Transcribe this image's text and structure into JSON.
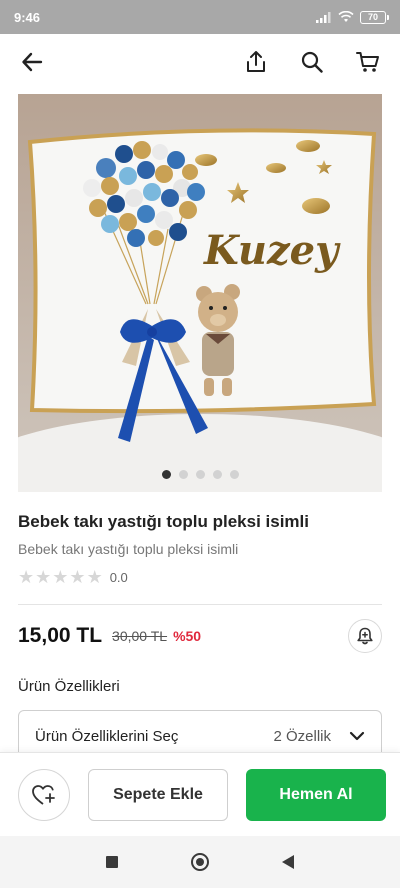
{
  "status_bar": {
    "time": "9:46",
    "battery": "70"
  },
  "header": {
    "back_icon": "arrow-left-icon",
    "share_icon": "share-icon",
    "search_icon": "search-icon",
    "cart_icon": "cart-icon"
  },
  "product": {
    "image_text": "Kuzey",
    "image_count": 5,
    "active_image": 1,
    "title": "Bebek takı yastığı toplu pleksi isimli",
    "subtitle": "Bebek takı yastığı toplu pleksi isimli",
    "rating_value": "0.0",
    "rating_stars": 0,
    "price": "15,00 TL",
    "old_price": "30,00 TL",
    "discount": "%50"
  },
  "features": {
    "label": "Ürün Özellikleri",
    "select_label": "Ürün Özelliklerini Seç",
    "count": "2 Özellik"
  },
  "actions": {
    "favorite_icon": "heart-plus-icon",
    "add_to_cart": "Sepete Ekle",
    "buy_now": "Hemen Al"
  },
  "colors": {
    "buy_green": "#19b34c",
    "discount_red": "#e0283c",
    "status_bar": "#a8a8a8"
  }
}
